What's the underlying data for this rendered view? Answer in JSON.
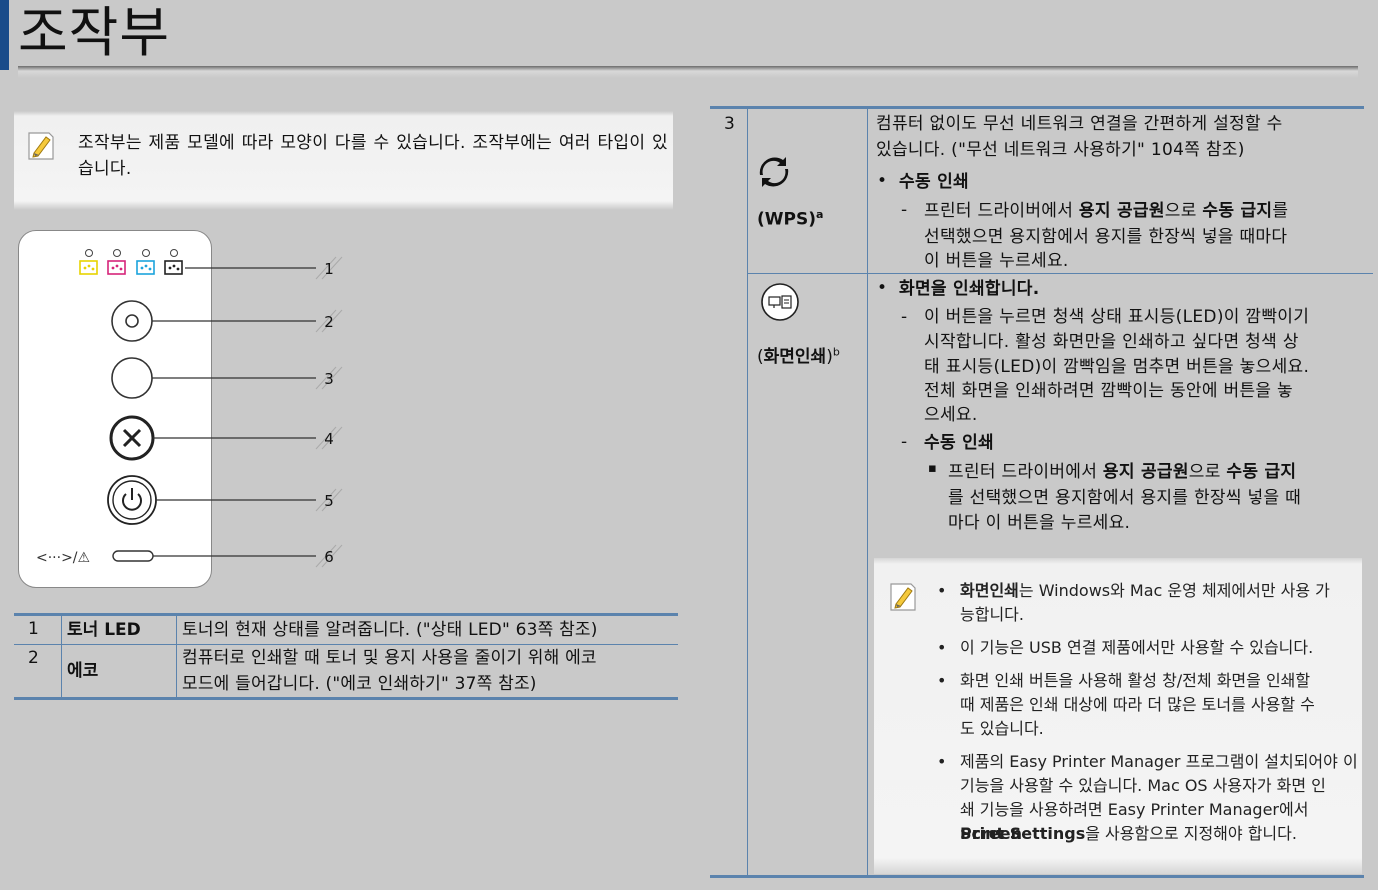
{
  "page_title": "조작부",
  "note1": "조작부는 제품 모델에 따라 모양이 다를 수 있습니다. 조작부에는 여러 타입이 있습니다.",
  "panel": {
    "callouts": [
      "1",
      "2",
      "3",
      "4",
      "5",
      "6"
    ],
    "status_symbol": "<···>/⚠"
  },
  "table_left": {
    "rows": [
      {
        "num": "1",
        "name": "토너 LED",
        "desc": "토너의 현재 상태를 알려줍니다. (\"상태 LED\" 63쪽 참조)"
      },
      {
        "num": "2",
        "name": "에코",
        "desc_line1": "컴퓨터로 인쇄할 때 토너 및 용지 사용을 줄이기 위해 에코",
        "desc_line2": "모드에 들어갑니다. (\"에코 인쇄하기\" 37쪽 참조)"
      }
    ]
  },
  "table_right": {
    "row_num": "3",
    "wps": {
      "label": "(WPS)",
      "sup": "a",
      "icon": "wps-icon",
      "desc_line1": "컴퓨터 없이도 무선 네트워크 연결을 간편하게 설정할 수",
      "desc_line2": "있습니다. (\"무선 네트워크 사용하기\" 104쪽 참조)",
      "bullet_title": "수동 인쇄",
      "sub_line1_pre": "프린터 드라이버에서 ",
      "sub_line1_b1": "용지 공급원",
      "sub_line1_mid": "으로 ",
      "sub_line1_b2": "수동 급지",
      "sub_line1_post": "를",
      "sub_line2": "선택했으면 용지함에서 용지를 한장씩 넣을 때마다",
      "sub_line3": "이 버튼을 누르세요."
    },
    "screen": {
      "label_open": "(",
      "label_bold": "화면인쇄",
      "label_close": ")",
      "sup": "b",
      "icon": "screen-print-icon",
      "bullet_title": "화면을 인쇄합니다.",
      "lines": [
        "이 버튼을 누르면 청색 상태 표시등(LED)이 깜빡이기",
        "시작합니다. 활성 화면만을 인쇄하고 싶다면 청색 상",
        "태 표시등(LED)이 깜빡임을 멈추면 버튼을 놓으세요.",
        "전체 화면을 인쇄하려면 깜빡이는 동안에 버튼을 놓",
        "으세요."
      ],
      "sub_title": "수동 인쇄",
      "sub_line1_pre": "프린터 드라이버에서 ",
      "sub_line1_b1": "용지 공급원",
      "sub_line1_mid": "으로 ",
      "sub_line1_b2": "수동 급지",
      "sub_line2": "를 선택했으면 용지함에서 용지를 한장씩 넣을 때",
      "sub_line3": "마다 이 버튼을 누르세요."
    },
    "note2": {
      "item1_b": "화면인쇄",
      "item1_rest": "는 Windows와 Mac 운영 체제에서만 사용 가",
      "item1_line2": "능합니다.",
      "item2": "이 기능은 USB 연결 제품에서만 사용할 수 있습니다.",
      "item3_lines": [
        "화면 인쇄 버튼을 사용해 활성 창/전체 화면을 인쇄할",
        "때 제품은 인쇄 대상에 따라 더 많은 토너를 사용할 수",
        "도 있습니다."
      ],
      "item4_line1": "제품의 Easy Printer Manager 프로그램이 설치되어야 이",
      "item4_line2": "기능을 사용할 수 있습니다. Mac OS 사용자가 화면 인",
      "item4_line3_pre": "쇄 기능을 사용하려면 Easy Printer Manager에서 ",
      "item4_line3_b": "Screen",
      "item4_line4_b": "Print Settings",
      "item4_line4_rest": "을 사용함으로 지정해야 합니다."
    }
  },
  "colors": {
    "accent": "#5b83ad",
    "side_tab": "#1a4c8a",
    "yellow": "#e8d300",
    "magenta": "#d6247a",
    "cyan": "#1ca3dc",
    "black": "#222222"
  }
}
